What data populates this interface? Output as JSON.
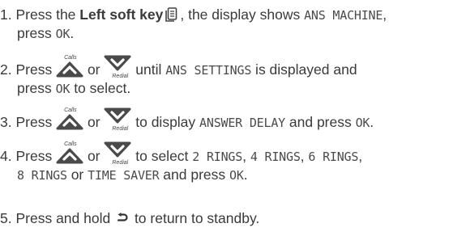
{
  "steps": [
    {
      "num": "1.",
      "lines": [
        [
          "Press the ",
          "Left soft key",
          "",
          ", the display shows ",
          "ANS MACHINE",
          ","
        ],
        [
          "press ",
          "OK",
          "."
        ]
      ]
    },
    {
      "num": "2.",
      "t1": " Press ",
      "t2": " or ",
      "t3": " until ",
      "lcd1": "ANS SETTINGS",
      "t4": " is displayed and",
      "l2a": "press ",
      "lcd2": "OK",
      "l2b": " to select."
    },
    {
      "num": "3.",
      "t1": " Press ",
      "t2": " or ",
      "t3": " to display ",
      "lcd1": "ANSWER DELAY",
      "t4": " and press ",
      "lcd2": "OK",
      "t5": "."
    },
    {
      "num": "4.",
      "t1": " Press ",
      "t2": " or ",
      "t3": " to select ",
      "r1": "2 RINGS",
      "c1": ", ",
      "r2": "4 RINGS",
      "c2": ", ",
      "r3": "6 RINGS",
      "c3": ",",
      "r4": "8 RINGS",
      "or": " or ",
      "r5": "TIME SAVER",
      "t6": " and press ",
      "lcd_ok": "OK",
      "dot": "."
    },
    {
      "num": "5.",
      "t1": " Press and hold ",
      "t2": " to return to standby."
    }
  ],
  "icon_labels": {
    "up": "Calls",
    "down": "Redial"
  },
  "icons": [
    "left-soft-key-icon",
    "up-nav-calls-icon",
    "down-nav-redial-icon",
    "back-arrow-icon"
  ],
  "colors": {
    "text": "#3a3a3a",
    "icon": "#444444",
    "background": "#ffffff"
  }
}
